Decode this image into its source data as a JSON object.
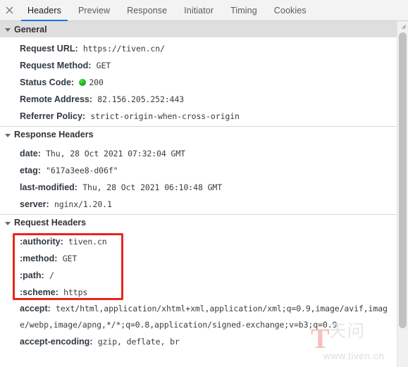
{
  "tabbar": {
    "close_icon": "close-icon",
    "tabs": [
      {
        "label": "Headers",
        "active": true
      },
      {
        "label": "Preview",
        "active": false
      },
      {
        "label": "Response",
        "active": false
      },
      {
        "label": "Initiator",
        "active": false
      },
      {
        "label": "Timing",
        "active": false
      },
      {
        "label": "Cookies",
        "active": false
      }
    ]
  },
  "sections": {
    "general": {
      "title": "General",
      "rows": [
        {
          "key": "Request URL:",
          "value": "https://tiven.cn/"
        },
        {
          "key": "Request Method:",
          "value": "GET"
        },
        {
          "key": "Status Code:",
          "value": "200",
          "status_dot": "#22b014"
        },
        {
          "key": "Remote Address:",
          "value": "82.156.205.252:443"
        },
        {
          "key": "Referrer Policy:",
          "value": "strict-origin-when-cross-origin"
        }
      ]
    },
    "response_headers": {
      "title": "Response Headers",
      "rows": [
        {
          "key": "date:",
          "value": "Thu, 28 Oct 2021 07:32:04 GMT"
        },
        {
          "key": "etag:",
          "value": "\"617a3ee8-d06f\""
        },
        {
          "key": "last-modified:",
          "value": "Thu, 28 Oct 2021 06:10:48 GMT"
        },
        {
          "key": "server:",
          "value": "nginx/1.20.1"
        }
      ]
    },
    "request_headers": {
      "title": "Request Headers",
      "rows": [
        {
          "key": ":authority:",
          "value": "tiven.cn"
        },
        {
          "key": ":method:",
          "value": "GET"
        },
        {
          "key": ":path:",
          "value": "/"
        },
        {
          "key": ":scheme:",
          "value": "https"
        },
        {
          "key": "accept:",
          "value": "text/html,application/xhtml+xml,application/xml;q=0.9,image/avif,image/webp,image/apng,*/*;q=0.8,application/signed-exchange;v=b3;q=0.9"
        },
        {
          "key": "accept-encoding:",
          "value": "gzip, deflate, br"
        }
      ],
      "annotation_color": "#e8261c"
    }
  },
  "watermark": {
    "glyph": "T",
    "cjk": "天问",
    "url": "www.tiven.cn"
  },
  "scrollbar": {
    "up_arrow_icon": "triangle-up-icon"
  }
}
